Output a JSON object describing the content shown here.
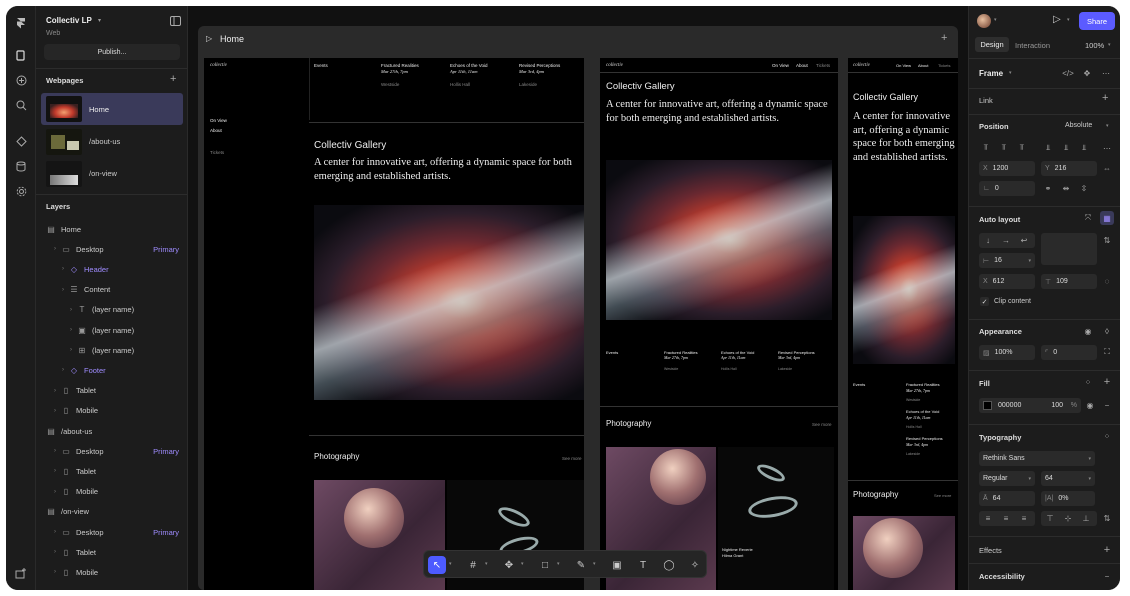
{
  "project": {
    "name": "Collectiv LP",
    "subtitle": "Web",
    "publish_label": "Publish..."
  },
  "webpages": {
    "heading": "Webpages",
    "items": [
      {
        "label": "Home"
      },
      {
        "label": "/about-us"
      },
      {
        "label": "/on-view"
      }
    ]
  },
  "layers": {
    "heading": "Layers",
    "rows": [
      {
        "label": "Home",
        "icon": "page-icon"
      },
      {
        "label": "Desktop",
        "icon": "desktop-icon",
        "tag": "Primary"
      },
      {
        "label": "Header",
        "icon": "component-icon"
      },
      {
        "label": "Content",
        "icon": "stack-icon"
      },
      {
        "label": "(layer name)",
        "icon": "text-icon"
      },
      {
        "label": "(layer name)",
        "icon": "image-icon"
      },
      {
        "label": "(layer name)",
        "icon": "frame-icon"
      },
      {
        "label": "Footer",
        "icon": "component-icon"
      },
      {
        "label": "Tablet",
        "icon": "tablet-icon"
      },
      {
        "label": "Mobile",
        "icon": "mobile-icon"
      },
      {
        "label": "/about-us",
        "icon": "page-icon"
      },
      {
        "label": "Desktop",
        "icon": "desktop-icon",
        "tag": "Primary"
      },
      {
        "label": "Tablet",
        "icon": "tablet-icon"
      },
      {
        "label": "Mobile",
        "icon": "mobile-icon"
      },
      {
        "label": "/on-view",
        "icon": "page-icon"
      },
      {
        "label": "Desktop",
        "icon": "desktop-icon",
        "tag": "Primary"
      },
      {
        "label": "Tablet",
        "icon": "tablet-icon"
      },
      {
        "label": "Mobile",
        "icon": "mobile-icon"
      }
    ]
  },
  "canvas": {
    "title": "Home",
    "add_label": "+"
  },
  "site": {
    "logo": "collectiv",
    "nav": [
      "On View",
      "About",
      "Tickets"
    ],
    "events_label": "Events",
    "events": [
      {
        "title": "Fractured Realities",
        "date": "Mar 27th, 7pm",
        "place": "Westside"
      },
      {
        "title": "Echoes of the Void",
        "date": "Apr 11th, 11am",
        "place": "Hollis Hall"
      },
      {
        "title": "Revised Perceptions",
        "date": "Mar 3rd, 4pm",
        "place": "Lakeside"
      }
    ],
    "heading": "Collectiv Gallery",
    "tagline": "A center for innovative art, offering a dynamic space for both emerging and established artists.",
    "photography_label": "Photography",
    "see_more": "See more",
    "caption": "Nightime Reverie\nHilma Grant",
    "caption_title": "Nightime Reverie",
    "caption_artist": "Hilma Grant"
  },
  "right_panel": {
    "tabs": [
      "Design",
      "Interaction"
    ],
    "zoom": "100%",
    "share_label": "Share",
    "frame_label": "Frame",
    "link_label": "Link",
    "position": {
      "label": "Position",
      "mode": "Absolute",
      "x": "1200",
      "y": "216",
      "rotation": "0"
    },
    "auto_layout": {
      "label": "Auto layout",
      "gap": "16",
      "x": "612",
      "h": "109",
      "clip_label": "Clip content"
    },
    "appearance": {
      "label": "Appearance",
      "opacity": "100%",
      "radius": "0"
    },
    "fill": {
      "label": "Fill",
      "hex": "000000",
      "opacity": "100",
      "unit": "%",
      "color": "#000000"
    },
    "typography": {
      "label": "Typography",
      "font": "Rethink Sans",
      "weight": "Regular",
      "size": "64",
      "line_height": "64",
      "letter_spacing": "0%"
    },
    "effects_label": "Effects",
    "accessibility_label": "Accessibility"
  },
  "colors": {
    "accent": "#5b5bff",
    "component": "#9f8cff"
  }
}
